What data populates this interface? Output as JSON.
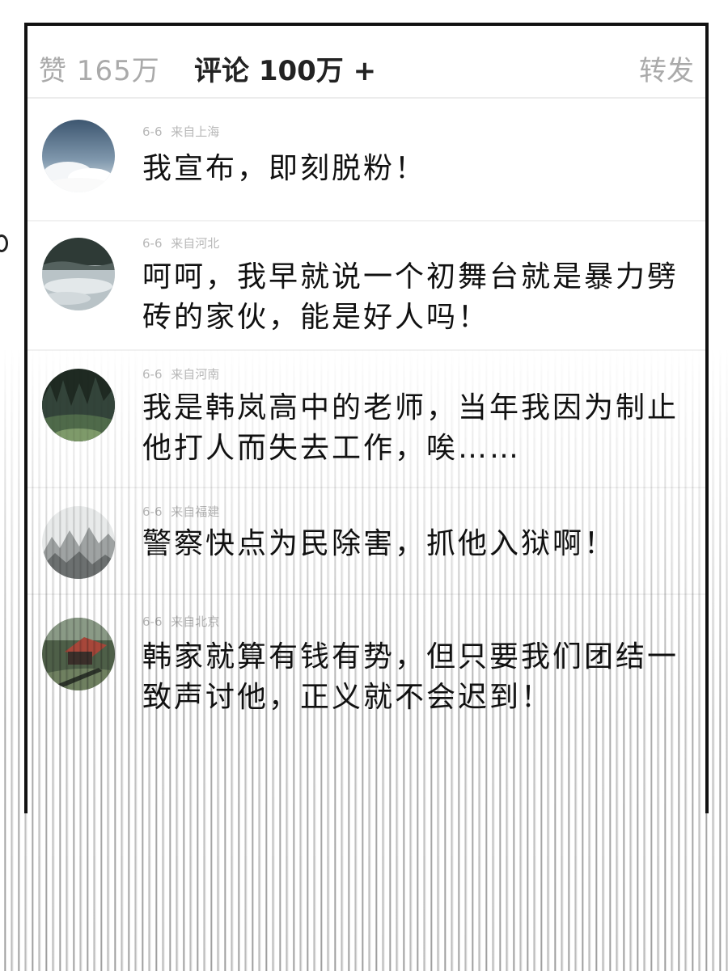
{
  "tabs": {
    "likes": "赞 165万",
    "comments": "评论 100万 +",
    "forward": "转发"
  },
  "comments": [
    {
      "date": "6-6",
      "location": "来自上海",
      "text": "我宣布，即刻脱粉！",
      "avatar": "sky-clouds"
    },
    {
      "date": "6-6",
      "location": "来自河北",
      "text": "呵呵，我早就说一个初舞台就是暴力劈砖的家伙，能是好人吗！",
      "avatar": "misty-lake"
    },
    {
      "date": "6-6",
      "location": "来自河南",
      "text": "我是韩岚高中的老师，当年我因为制止他打人而失去工作，唉……",
      "avatar": "forest"
    },
    {
      "date": "6-6",
      "location": "来自福建",
      "text": "警察快点为民除害，抓他入狱啊！",
      "avatar": "misty-mountains"
    },
    {
      "date": "6-6",
      "location": "来自北京",
      "text": "韩家就算有钱有势，但只要我们团结一致声讨他，正义就不会迟到！",
      "avatar": "red-roof-house"
    }
  ]
}
